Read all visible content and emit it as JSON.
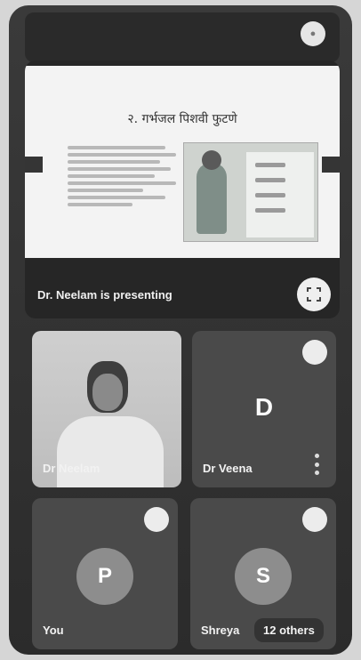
{
  "top_bar": {
    "indicator_icon": "status-icon"
  },
  "presentation": {
    "slide_title": "२. गर्भजल पिशवी फुटणे",
    "slide_options": [
      "C...",
      "G...",
      "A...",
      "T..."
    ],
    "presenter_label": "Dr. Neelam is presenting",
    "fullscreen_icon": "fullscreen-icon"
  },
  "participants": [
    {
      "name": "Dr Neelam",
      "type": "video"
    },
    {
      "name": "Dr Veena",
      "type": "initial",
      "initial": "D"
    },
    {
      "name": "You",
      "type": "avatar",
      "initial": "P"
    },
    {
      "name": "Shreya",
      "type": "avatar",
      "initial": "S",
      "others_label": "12 others"
    }
  ],
  "colors": {
    "background": "#2b2b2b",
    "tile": "#4a4a4a",
    "accent_light": "#ececec"
  }
}
